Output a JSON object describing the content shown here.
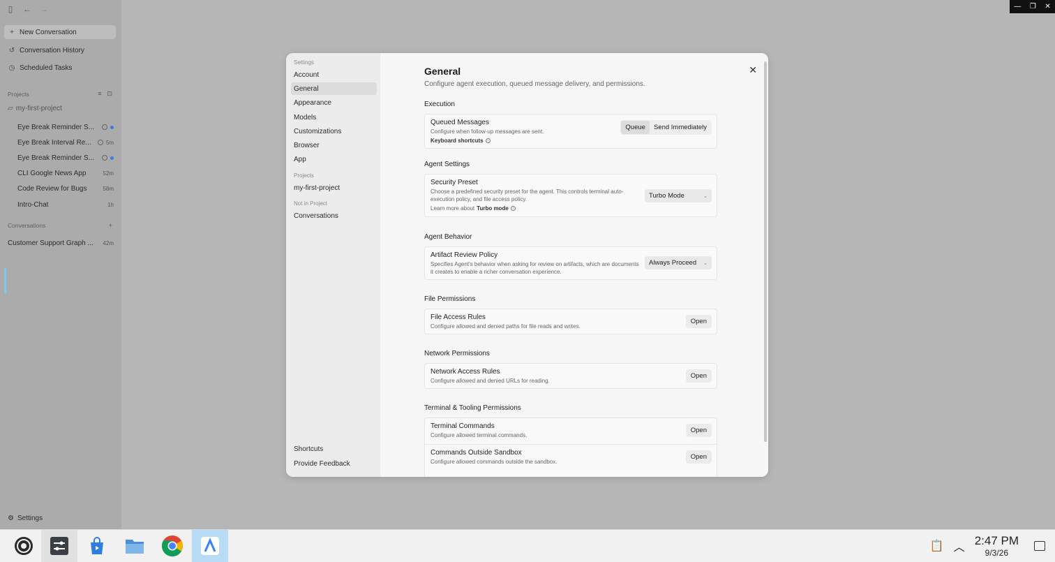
{
  "background_app": {
    "nav": {
      "new_conversation": "New Conversation",
      "conversation_history": "Conversation History",
      "scheduled_tasks": "Scheduled Tasks"
    },
    "projects_label": "Projects",
    "project_folder": "my-first-project",
    "project_items": [
      {
        "title": "Eye Break Reminder S...",
        "meta": ""
      },
      {
        "title": "Eye Break Interval Re...",
        "meta": "5m"
      },
      {
        "title": "Eye Break Reminder S...",
        "meta": ""
      },
      {
        "title": "CLI Google News App",
        "meta": "52m"
      },
      {
        "title": "Code Review for Bugs",
        "meta": "58m"
      },
      {
        "title": "Intro-Chat",
        "meta": "1h"
      }
    ],
    "conversations_label": "Conversations",
    "conversation_items": [
      {
        "title": "Customer Support Graph ...",
        "meta": "42m"
      }
    ],
    "settings_label": "Settings"
  },
  "settings": {
    "side_header": "Settings",
    "menu": [
      "Account",
      "General",
      "Appearance",
      "Models",
      "Customizations",
      "Browser",
      "App"
    ],
    "projects_header": "Projects",
    "project": "my-first-project",
    "not_in_project_header": "Not in Project",
    "conversations": "Conversations",
    "shortcuts": "Shortcuts",
    "feedback": "Provide Feedback",
    "title": "General",
    "subtitle": "Configure agent execution, queued message delivery, and permissions.",
    "execution": {
      "header": "Execution",
      "name": "Queued Messages",
      "desc": "Configure when follow-up messages are sent.",
      "extra": "Keyboard shortcuts",
      "opt_queue": "Queue",
      "opt_send": "Send Immediately"
    },
    "agent_settings": {
      "header": "Agent Settings",
      "name": "Security Preset",
      "desc": "Choose a predefined security preset for the agent. This controls terminal auto-execution policy, and file access policy.",
      "learn_prefix": "Learn more about",
      "learn_link": "Turbo mode",
      "value": "Turbo Mode"
    },
    "agent_behavior": {
      "header": "Agent Behavior",
      "name": "Artifact Review Policy",
      "desc": "Specifies Agent's behavior when asking for review on artifacts, which are documents it creates to enable a richer conversation experience.",
      "value": "Always Proceed"
    },
    "file_permissions": {
      "header": "File Permissions",
      "name": "File Access Rules",
      "desc": "Configure allowed and denied paths for file reads and writes.",
      "button": "Open"
    },
    "network_permissions": {
      "header": "Network Permissions",
      "name": "Network Access Rules",
      "desc": "Configure allowed and denied URLs for reading.",
      "button": "Open"
    },
    "terminal_permissions": {
      "header": "Terminal & Tooling Permissions",
      "rows": [
        {
          "name": "Terminal Commands",
          "desc": "Configure allowed terminal commands.",
          "button": "Open"
        },
        {
          "name": "Commands Outside Sandbox",
          "desc": "Configure allowed commands outside the sandbox.",
          "button": "Open"
        }
      ]
    }
  },
  "taskbar": {
    "time": "2:47 PM",
    "date": "9/3/26"
  }
}
